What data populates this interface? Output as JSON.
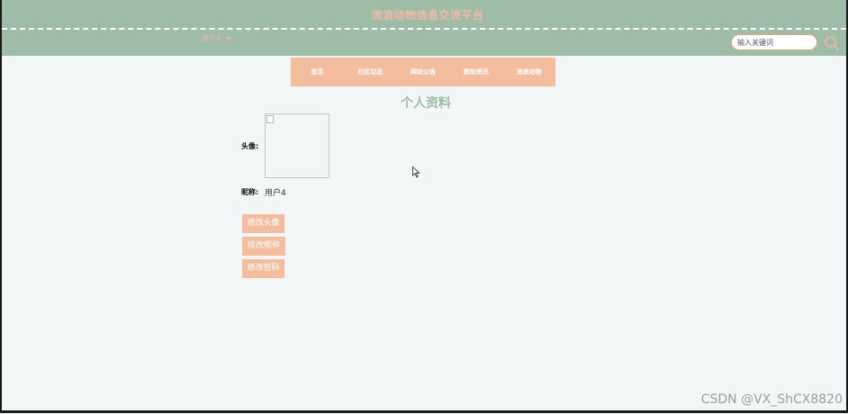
{
  "header": {
    "site_title": "流浪动物信息交流平台",
    "user_menu_label": "用户4",
    "search_placeholder": "输入关键词"
  },
  "nav": {
    "items": [
      "首页",
      "社区动态",
      "网站公告",
      "救助资讯",
      "流浪动物"
    ]
  },
  "profile": {
    "title": "个人资料",
    "avatar_label": "头像:",
    "nickname_label": "昵称:",
    "nickname_value": "用户4",
    "buttons": {
      "change_avatar": "修改头像",
      "change_nickname": "修改昵称",
      "change_password": "修改密码"
    }
  },
  "watermark": "CSDN @VX_ShCX8820",
  "colors": {
    "header_green": "#9fbca7",
    "accent_peach": "#f4bd9e",
    "title_green": "#9fbca7"
  }
}
